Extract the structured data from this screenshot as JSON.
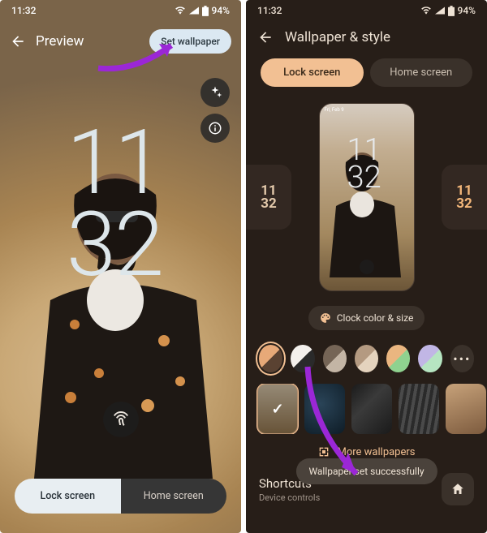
{
  "status": {
    "time": "11:32",
    "battery": "94%"
  },
  "phone1": {
    "title": "Preview",
    "set_wallpaper": "Set wallpaper",
    "clock_hh": "11",
    "clock_mm": "32",
    "tabs": {
      "lock": "Lock screen",
      "home": "Home screen"
    }
  },
  "phone2": {
    "title": "Wallpaper & style",
    "tabs": {
      "lock": "Lock screen",
      "home": "Home screen"
    },
    "preview_status": "Fri, Feb 9",
    "clock_hh": "11",
    "clock_mm": "32",
    "side_left_hh": "11",
    "side_left_mm": "32",
    "side_right_hh": "11",
    "side_right_mm": "32",
    "clock_color_btn": "Clock color & size",
    "swatches": [
      "#e7a978",
      "#f3f0ec",
      "#756556",
      "#b49a81",
      "#eab680",
      "#c1b6e5"
    ],
    "more_wallpapers": "More wallpapers",
    "shortcuts": {
      "title": "Shortcuts",
      "subtitle": "Device controls"
    },
    "toast": "Wallpaper set successfully"
  }
}
